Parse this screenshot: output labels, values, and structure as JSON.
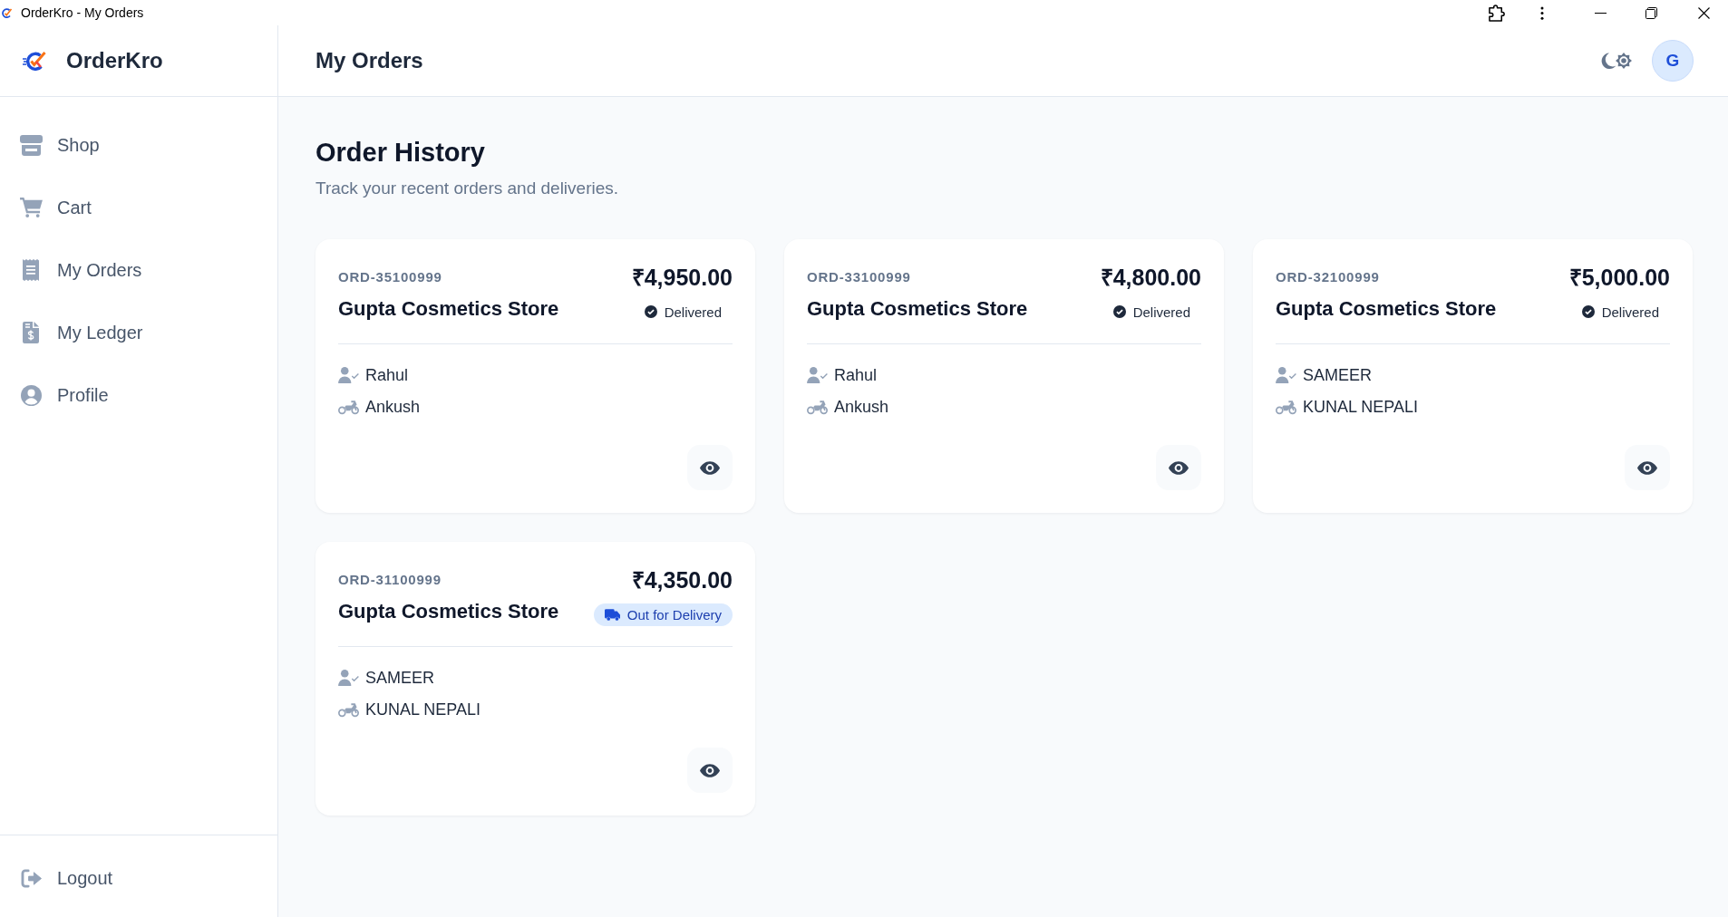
{
  "window": {
    "title": "OrderKro - My Orders"
  },
  "sidebar": {
    "brand": "OrderKro",
    "items": [
      {
        "label": "Shop",
        "kind": "shop"
      },
      {
        "label": "Cart",
        "kind": "cart"
      },
      {
        "label": "My Orders",
        "kind": "orders"
      },
      {
        "label": "My Ledger",
        "kind": "ledger"
      },
      {
        "label": "Profile",
        "kind": "profile"
      }
    ],
    "footer_item": {
      "label": "Logout"
    }
  },
  "header": {
    "title": "My Orders",
    "avatar_initial": "G"
  },
  "content": {
    "title": "Order History",
    "subtitle": "Track your recent orders and deliveries."
  },
  "orders": [
    {
      "order_id": "ORD-35100999",
      "total": "₹4,950.00",
      "store": "Gupta Cosmetics Store",
      "status": {
        "label": "Delivered",
        "kind": "delivered"
      },
      "people": [
        {
          "kind": "staff",
          "name": "Rahul"
        },
        {
          "kind": "rider",
          "name": "Ankush"
        }
      ]
    },
    {
      "order_id": "ORD-33100999",
      "total": "₹4,800.00",
      "store": "Gupta Cosmetics Store",
      "status": {
        "label": "Delivered",
        "kind": "delivered"
      },
      "people": [
        {
          "kind": "staff",
          "name": "Rahul"
        },
        {
          "kind": "rider",
          "name": "Ankush"
        }
      ]
    },
    {
      "order_id": "ORD-32100999",
      "total": "₹5,000.00",
      "store": "Gupta Cosmetics Store",
      "status": {
        "label": "Delivered",
        "kind": "delivered"
      },
      "people": [
        {
          "kind": "staff",
          "name": "SAMEER"
        },
        {
          "kind": "rider",
          "name": "KUNAL NEPALI"
        }
      ]
    },
    {
      "order_id": "ORD-31100999",
      "total": "₹4,350.00",
      "store": "Gupta Cosmetics Store",
      "status": {
        "label": "Out for Delivery",
        "kind": "out_for_delivery"
      },
      "people": [
        {
          "kind": "staff",
          "name": "SAMEER"
        },
        {
          "kind": "rider",
          "name": "KUNAL NEPALI"
        }
      ]
    }
  ]
}
